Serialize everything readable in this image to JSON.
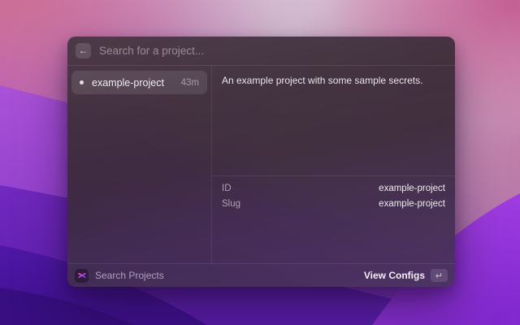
{
  "window": {
    "search": {
      "placeholder": "Search for a project...",
      "back_icon": "←"
    },
    "list": {
      "items": [
        {
          "label": "example-project",
          "accessory": "43m",
          "selected": true,
          "bullet_icon": "•"
        }
      ]
    },
    "detail": {
      "description": "An example project with some sample secrets.",
      "metadata": [
        {
          "label": "ID",
          "value": "example-project"
        },
        {
          "label": "Slug",
          "value": "example-project"
        }
      ]
    },
    "footer": {
      "command_name": "Search Projects",
      "extension_icon": "asterisk-icon",
      "primary_action": "View Configs",
      "enter_symbol": "↵"
    }
  },
  "colors": {
    "selection_highlight": "#5a4c59",
    "icon_pink": "#f056c7",
    "icon_purple": "#7b2ff0",
    "wallpaper_top": "#cfcbdb",
    "wallpaper_bottom_purple": "#5a1dac",
    "window_tint": "#3d2e3a"
  }
}
